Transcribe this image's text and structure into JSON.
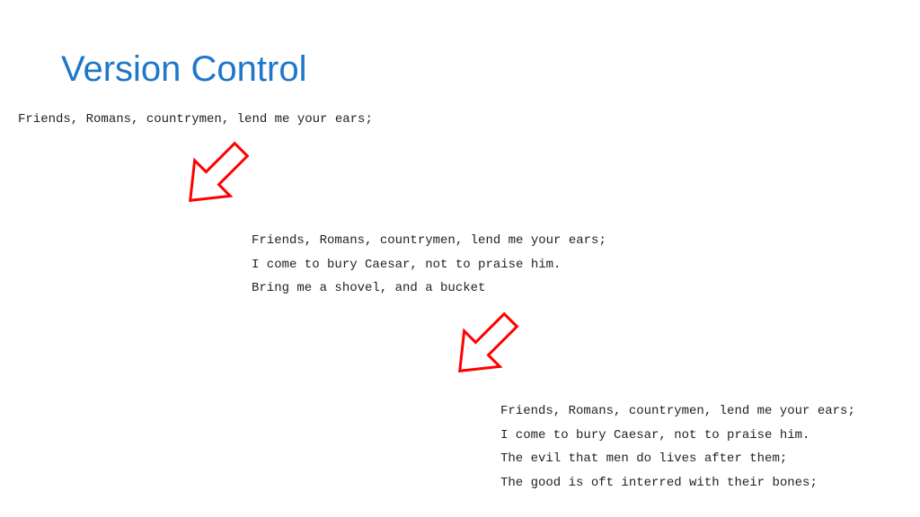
{
  "title": "Version Control",
  "block1": {
    "line1": "Friends, Romans, countrymen, lend me your ears;"
  },
  "block2": {
    "line1": "Friends, Romans, countrymen, lend me your ears;",
    "line2": "I come to bury Caesar, not to praise him.",
    "line3": "Bring me a shovel, and a bucket"
  },
  "block3": {
    "line1": "Friends, Romans, countrymen, lend me your ears;",
    "line2": "I come to bury Caesar, not to praise him.",
    "line3": "The evil that men do lives after them;",
    "line4": "The good is oft interred with their bones;"
  },
  "colors": {
    "title": "#1F77C9",
    "arrow_stroke": "#FF0000",
    "arrow_fill": "#FFFFFF"
  }
}
